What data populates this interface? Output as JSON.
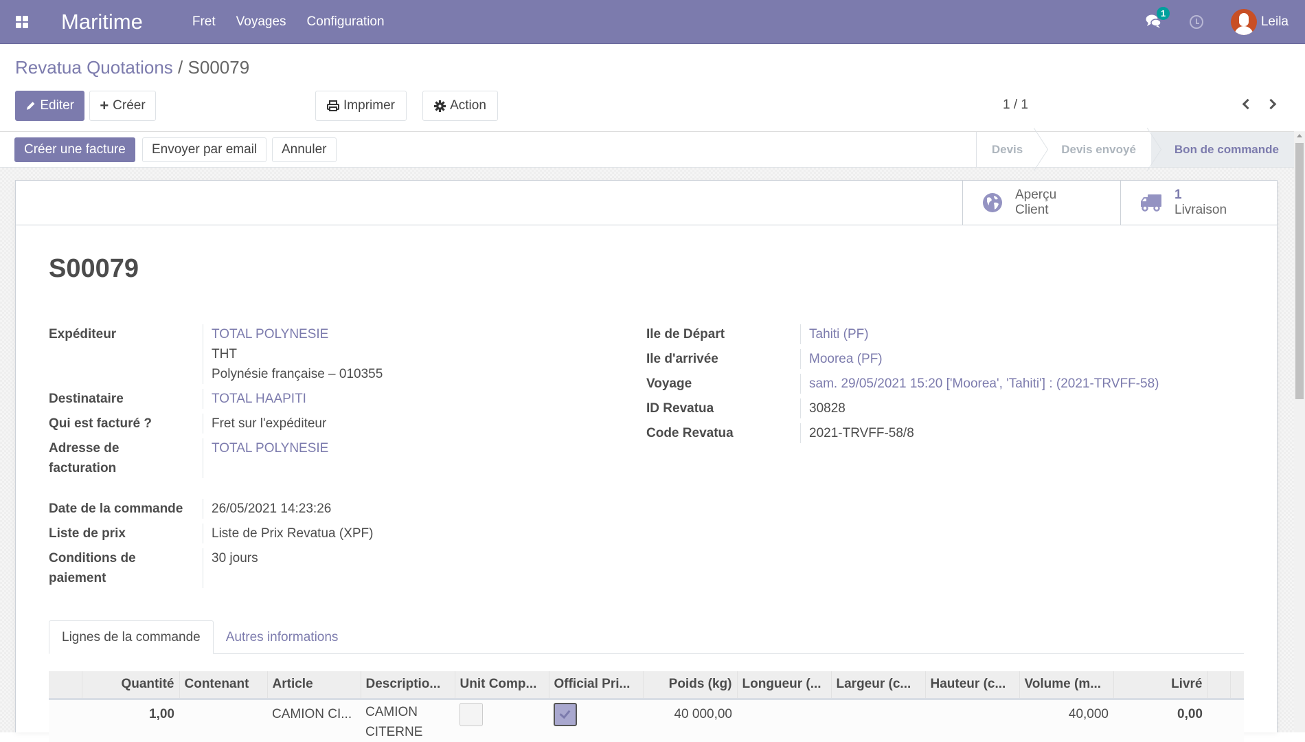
{
  "navbar": {
    "app_name": "Maritime",
    "menu": [
      "Fret",
      "Voyages",
      "Configuration"
    ],
    "chat_count": "1",
    "user_name": "Leila",
    "accent_color": "#7c7bad"
  },
  "breadcrumb": {
    "parent": "Revatua Quotations",
    "separator": "/",
    "current": "S00079"
  },
  "toolbar": {
    "edit_label": "Editer",
    "create_label": "Créer",
    "print_label": "Imprimer",
    "action_label": "Action",
    "pager_value": "1 / 1"
  },
  "statusbar": {
    "buttons": [
      "Créer une facture",
      "Envoyer par email",
      "Annuler"
    ],
    "stages": [
      "Devis",
      "Devis envoyé",
      "Bon de commande"
    ],
    "active_stage": "Bon de commande"
  },
  "smart_buttons": {
    "preview": {
      "line1": "Aperçu",
      "line2": "Client"
    },
    "delivery": {
      "value": "1",
      "label": "Livraison"
    }
  },
  "record": {
    "title": "S00079",
    "left_fields": [
      {
        "label": "Expéditeur",
        "value_link": "TOTAL POLYNESIE",
        "extra": [
          "THT",
          "Polynésie française – 010355"
        ]
      },
      {
        "label": "Destinataire",
        "value_link": "TOTAL HAAPITI"
      },
      {
        "label": "Qui est facturé ?",
        "value": "Fret sur l'expéditeur"
      },
      {
        "label": "Adresse de facturation",
        "value_link": "TOTAL POLYNESIE"
      }
    ],
    "left_fields_2": [
      {
        "label": "Date de la commande",
        "value": "26/05/2021 14:23:26"
      },
      {
        "label": "Liste de prix",
        "value": "Liste de Prix Revatua (XPF)"
      },
      {
        "label": "Conditions de paiement",
        "value": "30 jours"
      }
    ],
    "right_fields": [
      {
        "label": "Ile de Départ",
        "value_link": "Tahiti (PF)"
      },
      {
        "label": "Ile d'arrivée",
        "value_link": "Moorea (PF)"
      },
      {
        "label": "Voyage",
        "value_link": "sam. 29/05/2021 15:20 ['Moorea', 'Tahiti'] : (2021-TRVFF-58)"
      },
      {
        "label": "ID Revatua",
        "value": "30828"
      },
      {
        "label": "Code Revatua",
        "value": "2021-TRVFF-58/8"
      }
    ]
  },
  "tabs": [
    "Lignes de la commande",
    "Autres informations"
  ],
  "order_lines": {
    "columns": [
      "Quantité",
      "Contenant",
      "Article",
      "Descriptio...",
      "Unit Comp...",
      "Official Pri...",
      "Poids (kg)",
      "Longueur (...",
      "Largeur (c...",
      "Hauteur (c...",
      "Volume (m...",
      "Livré"
    ],
    "rows": [
      {
        "quantite": "1,00",
        "contenant": "",
        "article": "CAMION CI...",
        "description": "CAMION CITERNE",
        "unit_comp": false,
        "official_price": true,
        "poids": "40 000,00",
        "longueur": "",
        "largeur": "",
        "hauteur": "",
        "volume": "40,000",
        "livre": "0,00"
      }
    ]
  }
}
